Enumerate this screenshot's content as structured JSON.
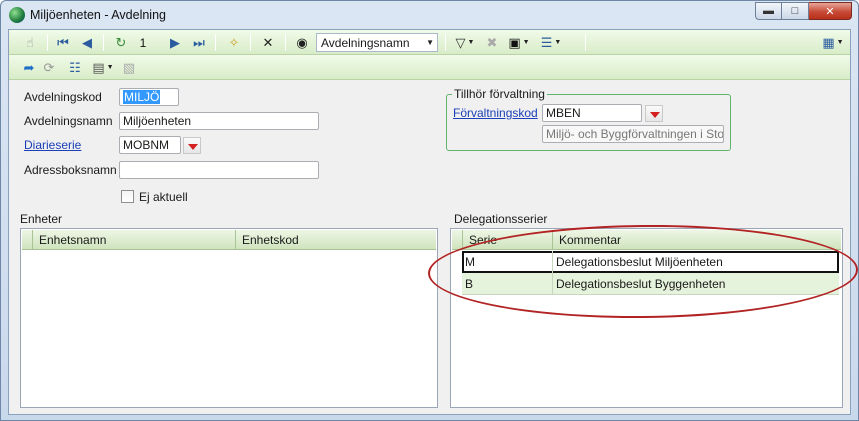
{
  "window": {
    "title": "Miljöenheten - Avdelning",
    "buttons": [
      "minimize",
      "maximize",
      "close"
    ]
  },
  "toolbar": {
    "record_number": "1",
    "nav_field": "Avdelningsnamn"
  },
  "form": {
    "avdelningskod_label": "Avdelningskod",
    "avdelningskod_value": "MILJÖ",
    "avdelningsnamn_label": "Avdelningsnamn",
    "avdelningsnamn_value": "Miljöenheten",
    "diarieserie_label": "Diarieserie",
    "diarieserie_value": "MOBNM",
    "adressboksnamn_label": "Adressboksnamn",
    "adressboksnamn_value": "",
    "ej_aktuell_label": "Ej aktuell",
    "ej_aktuell_checked": false
  },
  "forvaltning": {
    "legend": "Tillhör förvaltning",
    "kod_label": "Förvaltningskod",
    "kod_value": "MBEN",
    "namn_value": "Miljö- och Byggförvaltningen i Stork"
  },
  "enheter": {
    "title": "Enheter",
    "columns": [
      "Enhetsnamn",
      "Enhetskod"
    ],
    "rows": []
  },
  "delegation": {
    "title": "Delegationsserier",
    "columns": [
      "Serie",
      "Kommentar"
    ],
    "rows": [
      {
        "serie": "M",
        "kommentar": "Delegationsbeslut Miljöenheten"
      },
      {
        "serie": "B",
        "kommentar": "Delegationsbeslut Byggenheten"
      }
    ]
  },
  "colors": {
    "toolbar_bg": "#d8ecc8",
    "link": "#1a3fb8",
    "annotation": "#b22323"
  }
}
